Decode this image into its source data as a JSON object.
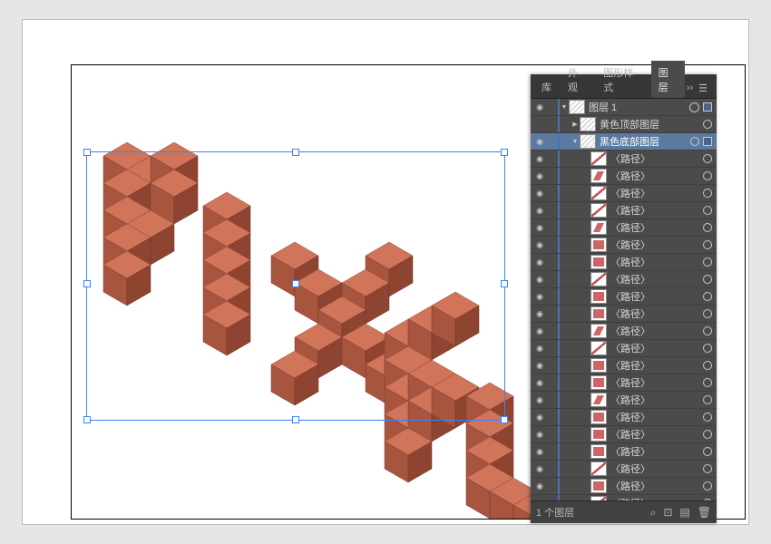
{
  "tabs": {
    "t0": "库",
    "t1": "外观",
    "t2": "图形样式",
    "t3": "图层",
    "more": "››",
    "menu": "☰",
    "active": 3
  },
  "layer_root": "图层 1",
  "sublayers": {
    "yellow": "黄色顶部图层",
    "black": "黑色底部图层"
  },
  "path_label": "〈路径〉",
  "status": {
    "count": "1 个图层",
    "search": "⌕",
    "new": "⊡",
    "page": "▤",
    "trash": "🗑"
  },
  "icons": {
    "eye": "◉",
    "arrow_down": "▼",
    "arrow_right": "▶"
  },
  "path_thumbs": [
    "line",
    "poly-a",
    "line",
    "line",
    "poly-a",
    "poly",
    "poly",
    "line",
    "poly",
    "poly",
    "poly-a",
    "line",
    "poly",
    "poly",
    "poly-a",
    "poly",
    "poly",
    "poly",
    "line",
    "poly",
    "line"
  ]
}
